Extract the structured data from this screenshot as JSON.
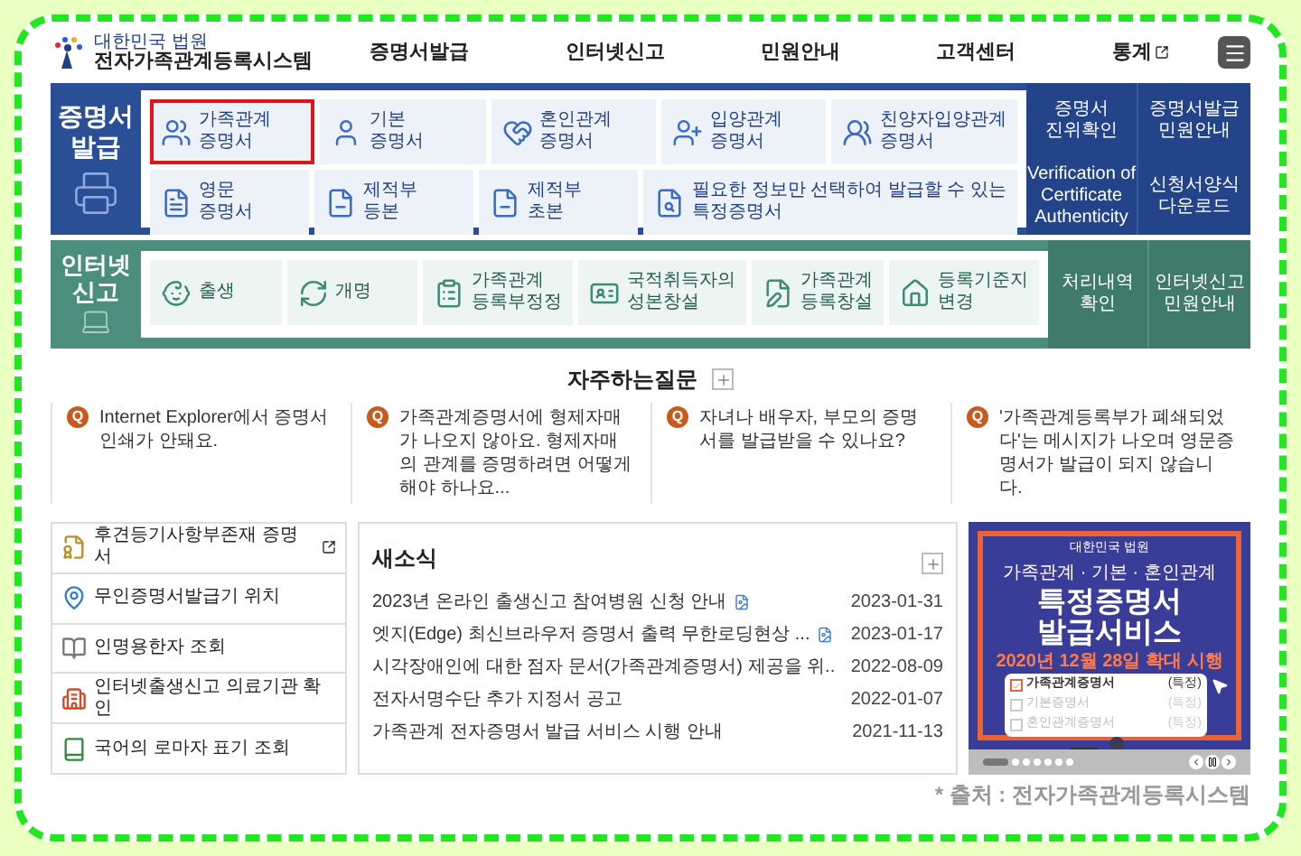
{
  "header": {
    "org": "대한민국 법원",
    "site": "전자가족관계등록시스템",
    "nav": [
      {
        "label": "증명서발급",
        "external": false
      },
      {
        "label": "인터넷신고",
        "external": false
      },
      {
        "label": "민원안내",
        "external": false
      },
      {
        "label": "고객센터",
        "external": false
      },
      {
        "label": "통계",
        "external": true
      }
    ]
  },
  "issue": {
    "title": "증명서\n발급",
    "tile_rows": [
      [
        {
          "label": "가족관계\n증명서",
          "selected": true
        },
        {
          "label": "기본\n증명서",
          "selected": false
        },
        {
          "label": "혼인관계\n증명서",
          "selected": false
        },
        {
          "label": "입양관계\n증명서",
          "selected": false
        },
        {
          "label": "친양자입양관계\n증명서",
          "selected": false
        }
      ],
      [
        {
          "label": "영문\n증명서",
          "selected": false
        },
        {
          "label": "제적부\n등본",
          "selected": false
        },
        {
          "label": "제적부\n초본",
          "selected": false
        },
        {
          "label": "필요한 정보만 선택하여 발급할 수 있는\n특정증명서",
          "selected": false
        }
      ]
    ],
    "links": [
      "증명서\n진위확인",
      "증명서발급\n민원안내",
      "Verification of\nCertificate\nAuthenticity",
      "신청서양식\n다운로드"
    ]
  },
  "report": {
    "title": "인터넷\n신고",
    "tiles": [
      {
        "label": "출생",
        "selected": false
      },
      {
        "label": "개명",
        "selected": false
      },
      {
        "label": "가족관계\n등록부정정",
        "selected": false
      },
      {
        "label": "국적취득자의\n성본창설",
        "selected": false
      },
      {
        "label": "가족관계\n등록창설",
        "selected": false
      },
      {
        "label": "등록기준지\n변경",
        "selected": false
      }
    ],
    "links": [
      "처리내역\n확인",
      "인터넷신고\n민원안내"
    ]
  },
  "faq": {
    "title": "자주하는질문",
    "items": [
      {
        "badge": "Q",
        "text": "Internet Explorer에서 증명서 인쇄가 안돼요."
      },
      {
        "badge": "Q",
        "text": "가족관계증명서에 형제자매가 나오지 않아요. 형제자매의 관계를 증명하려면 어떻게 해야 하나요..."
      },
      {
        "badge": "Q",
        "text": "자녀나 배우자, 부모의 증명서를 발급받을 수 있나요?"
      },
      {
        "badge": "Q",
        "text": "'가족관계등록부가 폐쇄되었다'는 메시지가 나오며 영문증명서가 발급이 되지 않습니다."
      }
    ]
  },
  "quick_links": [
    {
      "label": "후견등기사항부존재 증명서",
      "external": true
    },
    {
      "label": "무인증명서발급기 위치",
      "external": false
    },
    {
      "label": "인명용한자 조회",
      "external": false
    },
    {
      "label": "인터넷출생신고 의료기관 확인",
      "external": false
    },
    {
      "label": "국어의 로마자 표기 조회",
      "external": false
    }
  ],
  "news": {
    "title": "새소식",
    "items": [
      {
        "title": "2023년 온라인 출생신고 참여병원 신청 안내",
        "date": "2023-01-31",
        "attachment": true
      },
      {
        "title": "엣지(Edge) 최신브라우저 증명서 출력 무한로딩현상 ...",
        "date": "2023-01-17",
        "attachment": true
      },
      {
        "title": "시각장애인에 대한 점자 문서(가족관계증명서) 제공을 위..",
        "date": "2022-08-09",
        "attachment": false
      },
      {
        "title": "전자서명수단 추가 지정서 공고",
        "date": "2022-01-07",
        "attachment": false
      },
      {
        "title": "가족관계 전자증명서 발급 서비스 시행 안내",
        "date": "2021-11-13",
        "attachment": false
      }
    ]
  },
  "banner": {
    "org": "대한민국 법원",
    "subtitle": "가족관계 · 기본 · 혼인관계",
    "headline": "특정증명서\n발급서비스",
    "date": "2020년 12월 28일 확대 시행",
    "options": [
      {
        "label": "가족관계증명서",
        "tag": "(특정)",
        "checked": true
      },
      {
        "label": "기본증명서",
        "tag": "(특정)",
        "checked": false
      },
      {
        "label": "혼인관계증명서",
        "tag": "(특정)",
        "checked": false
      }
    ],
    "slides": [
      {
        "selected": true
      },
      {
        "selected": false
      },
      {
        "selected": false
      },
      {
        "selected": false
      },
      {
        "selected": false
      },
      {
        "selected": false
      },
      {
        "selected": false
      }
    ]
  },
  "caption": "* 출처 : 전자가족관계등록시스템"
}
